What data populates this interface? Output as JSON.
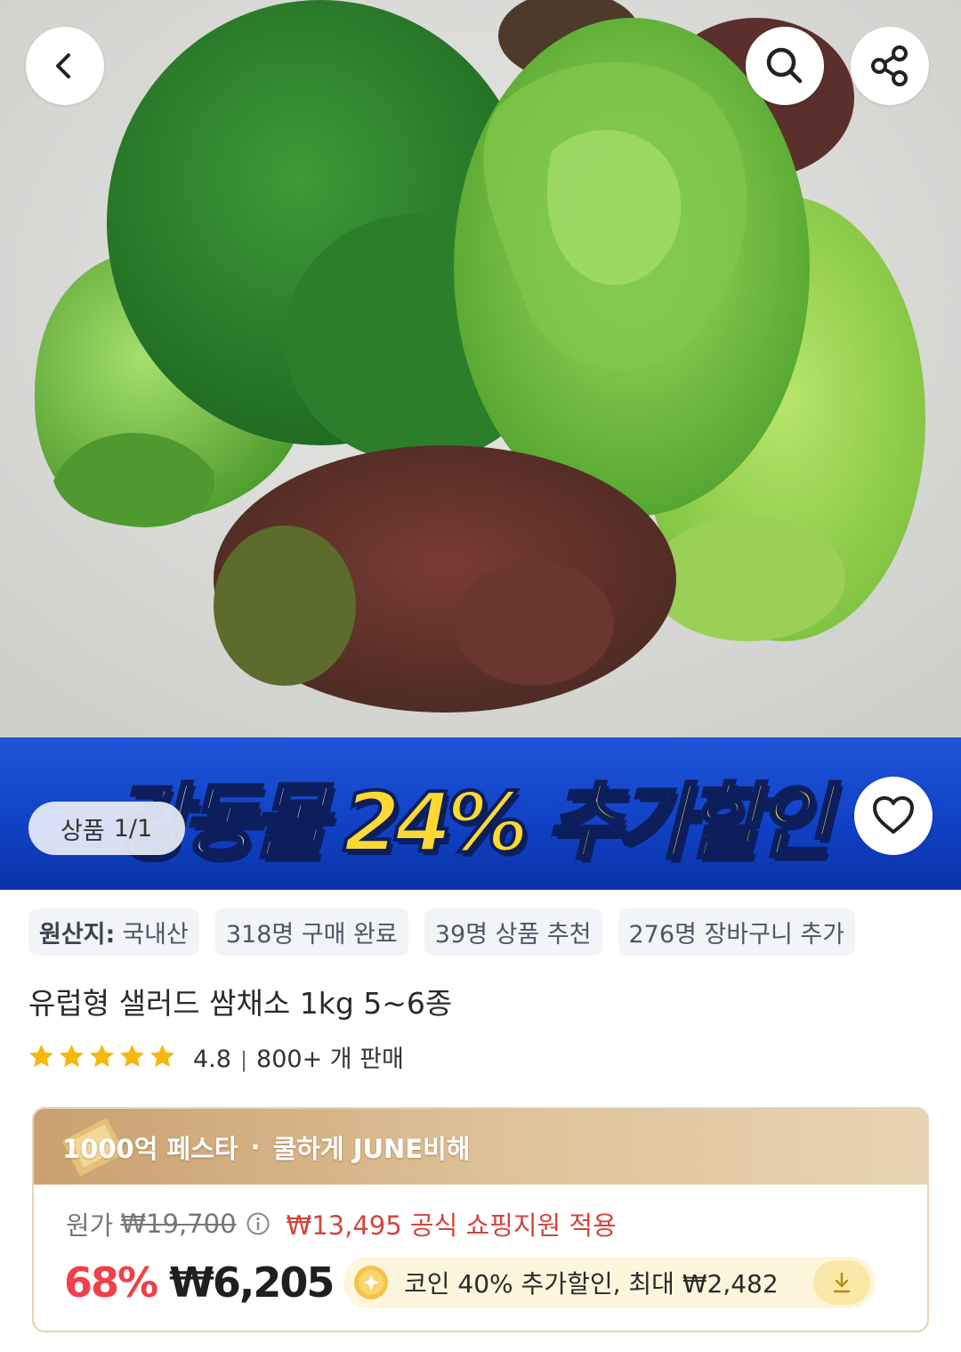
{
  "hero": {
    "image_description": "fresh salad greens (frisée, butter lettuce, red oak leaf, green leaf lettuce) on a light grey background",
    "back_icon": "chevron-left-icon",
    "search_icon": "search-icon",
    "share_icon": "share-icon"
  },
  "banner": {
    "text_white": "강동몰",
    "text_yellow": "24% 추가할인",
    "favorite_icon": "heart-icon",
    "colors": {
      "background": "#1142c7",
      "highlight": "#ffd931"
    }
  },
  "pager": {
    "label": "상품",
    "count": "1/1"
  },
  "chips": [
    {
      "strong": "원산지:",
      "text": "국내산"
    },
    {
      "strong": "",
      "text": "318명 구매 완료"
    },
    {
      "strong": "",
      "text": "39명 상품 추천"
    },
    {
      "strong": "",
      "text": "276명 장바구니 추가"
    }
  ],
  "product": {
    "title": "유럽형 샐러드 쌈채소 1kg 5~6종",
    "rating": "4.8",
    "stars": 5,
    "sold": "800+ 개 판매"
  },
  "price_card": {
    "event_name": "1000억 페스타",
    "event_dot": "·",
    "event_sub": "쿨하게 JUNE비해",
    "original_label": "원가",
    "original_price": "₩19,700",
    "official_price": "₩13,495 공식 쇼핑지원 적용",
    "discount_percent": "68%",
    "final_price": "₩6,205",
    "coin_text": "코인 40% 추가할인, 최대 ₩2,482",
    "colors": {
      "discount": "#f0404a",
      "official": "#d3463c",
      "header": "#caa06f",
      "coin_bg": "#fdf6dc"
    }
  }
}
